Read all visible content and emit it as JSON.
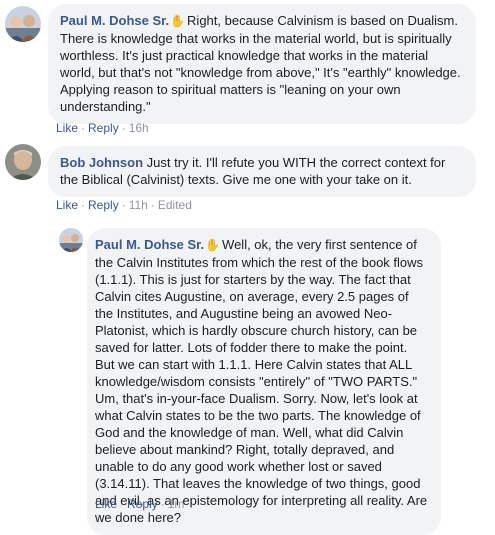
{
  "comments": [
    {
      "author": "Paul M. Dohse Sr.",
      "author_badge_icon": "waving-hand-icon",
      "author_badge_glyph": "✋",
      "text": "Right, because Calvinism is based on Dualism. There is knowledge that works in the material world, but is spiritually worthless. It's just practical knowledge that works in the material world, but that's not \"knowledge from above,\" It's \"earthly\" knowledge. Applying reason to spiritual matters is \"leaning on your own understanding.\"",
      "like_label": "Like",
      "reply_label": "Reply",
      "time": "16h"
    },
    {
      "author": "Bob Johnson",
      "text": "Just try it. I'll refute you WITH the correct context for the Biblical (Calvinist) texts. Give me one with your take on it.",
      "like_label": "Like",
      "reply_label": "Reply",
      "time": "11h",
      "edited_label": "Edited"
    },
    {
      "author": "Paul M. Dohse Sr.",
      "author_badge_icon": "waving-hand-icon",
      "author_badge_glyph": "✋",
      "text": "Well, ok, the very first sentence of the Calvin Institutes from which the rest of the book flows (1.1.1). This is just for starters by the way. The fact that Calvin cites Augustine, on average, every 2.5 pages of the Institutes, and Augustine being an avowed Neo-Platonist, which is hardly obscure church history, can be saved for latter. Lots of fodder there to make the point. But we can start with 1.1.1. Here Calvin states that ALL knowledge/wisdom consists \"entirely\" of \"TWO PARTS.\" Um, that's in-your-face Dualism. Sorry. Now, let's look at what Calvin states to be the two parts. The knowledge of God and the knowledge of man. Well, what did Calvin believe about mankind? Right, totally depraved, and unable to do any good work whether lost or saved (3.14.11). That leaves the knowledge of two things, good and evil, as an epistemology for interpreting all reality. Are we done here?",
      "like_label": "Like",
      "reply_label": "Reply",
      "time": "1m"
    }
  ],
  "separator": "·",
  "colors": {
    "bubble": "#f2f3f5",
    "author": "#385898",
    "text": "#1c1e21",
    "meta": "#90949c"
  }
}
